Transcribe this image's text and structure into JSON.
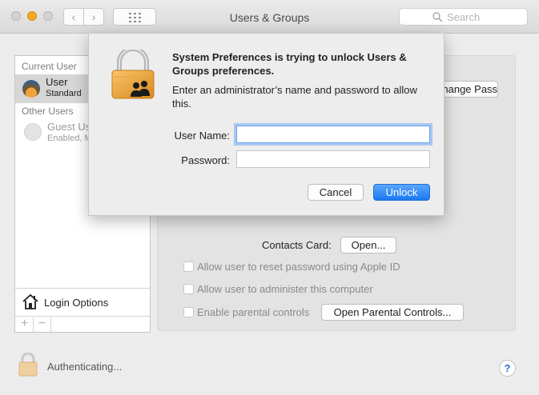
{
  "window": {
    "title": "Users & Groups",
    "search_placeholder": "Search"
  },
  "toolbar": {
    "back_icon": "chevron-left-icon",
    "forward_icon": "chevron-right-icon",
    "show_all_icon": "grid-icon"
  },
  "sidebar": {
    "current_user_label": "Current User",
    "current_user": {
      "name": "User",
      "role": "Standard"
    },
    "other_users_label": "Other Users",
    "guest_user": {
      "name": "Guest User",
      "status": "Enabled, Managed"
    },
    "login_options_label": "Login Options",
    "add_label": "+",
    "remove_label": "−"
  },
  "main": {
    "change_password_label": "Change Password...",
    "contacts_card_label": "Contacts Card:",
    "open_label": "Open...",
    "checkboxes": [
      {
        "label": "Allow user to reset password using Apple ID",
        "checked": false
      },
      {
        "label": "Allow user to administer this computer",
        "checked": false
      },
      {
        "label": "Enable parental controls",
        "checked": false
      }
    ],
    "open_parental_controls_label": "Open Parental Controls..."
  },
  "footer": {
    "status": "Authenticating...",
    "help_label": "?"
  },
  "dialog": {
    "title": "System Preferences is trying to unlock Users & Groups preferences.",
    "message": "Enter an administrator’s name and password to allow this.",
    "username_label": "User Name:",
    "username_value": "",
    "password_label": "Password:",
    "password_value": "",
    "cancel_label": "Cancel",
    "unlock_label": "Unlock",
    "accent_color": "#1b79f1"
  }
}
